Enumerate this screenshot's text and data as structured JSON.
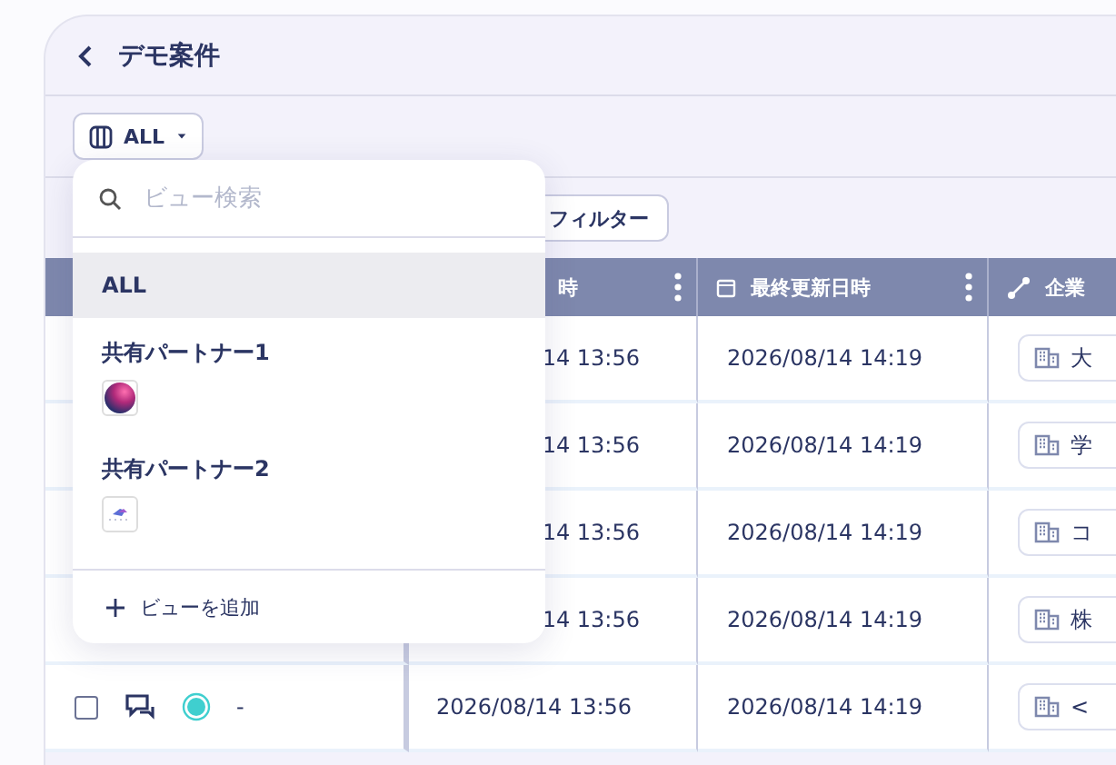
{
  "header": {
    "title": "デモ案件"
  },
  "view_button": {
    "label": "ALL"
  },
  "filter_button": {
    "label": "フィルター"
  },
  "table": {
    "columns": [
      {
        "kind": "blank"
      },
      {
        "kind": "cut",
        "label": "時"
      },
      {
        "kind": "date",
        "label": "最終更新日時"
      },
      {
        "kind": "link",
        "label": "企業"
      }
    ],
    "rows": [
      {
        "created": "14 13:56",
        "updated": "2026/08/14 14:19",
        "company": "大"
      },
      {
        "created": "14 13:56",
        "updated": "2026/08/14 14:19",
        "company": "学"
      },
      {
        "created": "14 13:56",
        "updated": "2026/08/14 14:19",
        "company": "コ"
      },
      {
        "created": "14 13:56",
        "updated": "2026/08/14 14:19",
        "company": "株"
      },
      {
        "checked": false,
        "status": "-",
        "created": "2026/08/14 13:56",
        "updated": "2026/08/14 14:19",
        "company": "<"
      }
    ]
  },
  "view_menu": {
    "search": {
      "placeholder": "ビュー検索"
    },
    "items": [
      {
        "label": "ALL",
        "selected": true,
        "kind": "plain"
      },
      {
        "label": "共有パートナー1",
        "selected": false,
        "kind": "avatar"
      },
      {
        "label": "共有パートナー2",
        "selected": false,
        "kind": "logo"
      }
    ],
    "add": {
      "label": "ビューを追加"
    }
  }
}
